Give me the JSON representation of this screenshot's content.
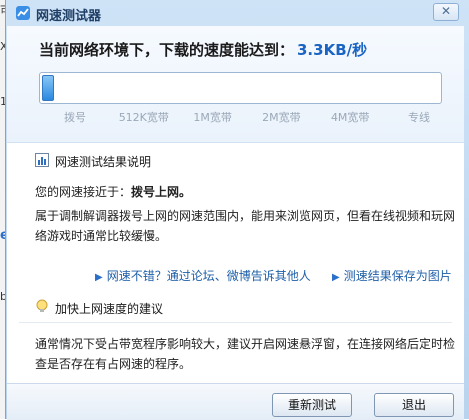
{
  "window": {
    "title": "网速测试器",
    "close_symbol": "✕"
  },
  "result": {
    "headline": "当前网络环境下，下载的速度能达到：",
    "speed": "3.3KB/秒",
    "progress_fraction": 0.008
  },
  "scale": {
    "labels": [
      "拨号",
      "512K宽带",
      "1M宽带",
      "2M宽带",
      "4M宽带",
      "专线"
    ]
  },
  "explanation": {
    "title": "网速测试结果说明",
    "close_to_prefix": "您的网速接近于：",
    "close_to_value": "拨号上网。",
    "description": "属于调制解调器拨号上网的网速范围内，能用来浏览网页，但看在线视频和玩网络游戏时通常比较缓慢。"
  },
  "links": {
    "share": "网速不错？通过论坛、微博告诉其他人",
    "save": "测速结果保存为图片"
  },
  "advice": {
    "title": "加快上网速度的建议",
    "text": "通常情况下受占带宽程序影响较大，建议开启网速悬浮窗，在连接网络后定时检查是否存在有占网速的程序。"
  },
  "buttons": {
    "retest": "重新测试",
    "exit": "退出"
  },
  "background_fragments": [
    "可",
    "X",
    "1",
    "e",
    "b"
  ]
}
